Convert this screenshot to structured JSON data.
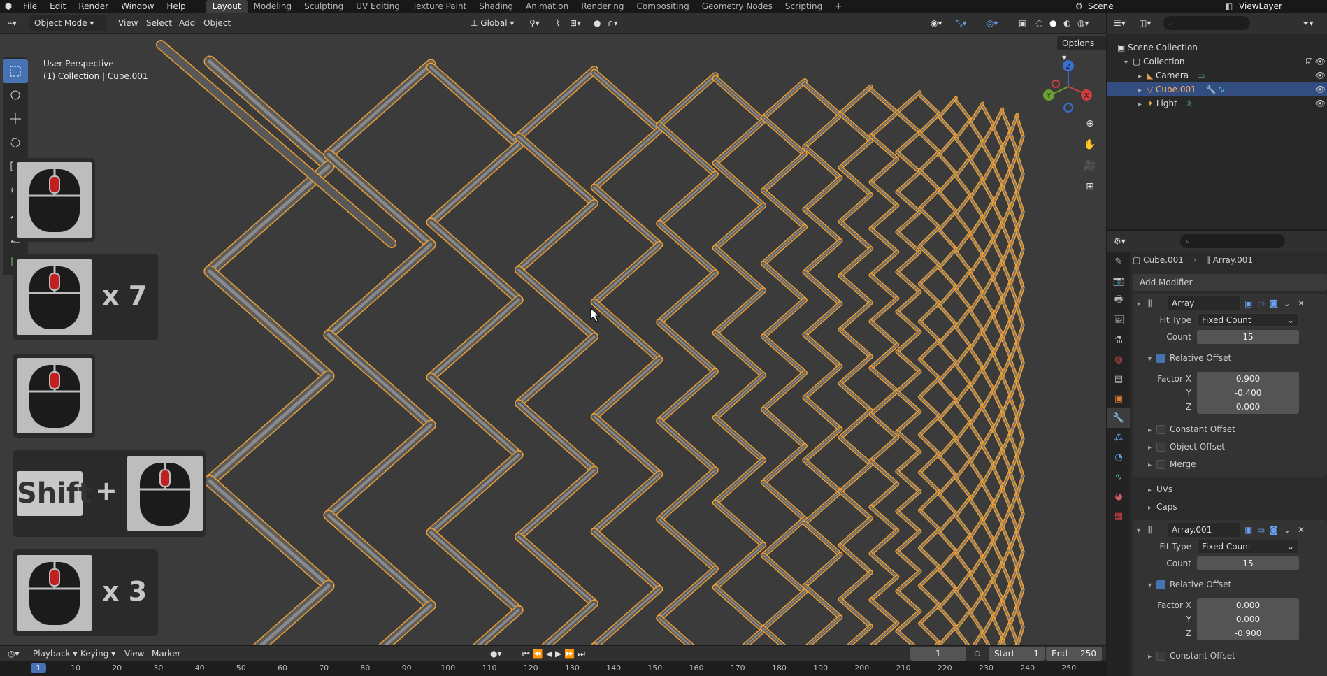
{
  "topbar": {
    "menus": [
      "File",
      "Edit",
      "Render",
      "Window",
      "Help"
    ],
    "workspaces": [
      "Layout",
      "Modeling",
      "Sculpting",
      "UV Editing",
      "Texture Paint",
      "Shading",
      "Animation",
      "Rendering",
      "Compositing",
      "Geometry Nodes",
      "Scripting"
    ],
    "active_workspace": "Layout",
    "scene": "Scene",
    "view_layer": "ViewLayer"
  },
  "viewport_header": {
    "mode": "Object Mode",
    "menus": [
      "View",
      "Select",
      "Add",
      "Object"
    ],
    "orientation": "Global",
    "options": "Options"
  },
  "viewport": {
    "perspective": "User Perspective",
    "collection_info": "(1) Collection | Cube.001",
    "gizmo_axes": [
      "Z",
      "Y",
      "X"
    ]
  },
  "key_overlays": [
    {
      "type": "mouse",
      "button": "middle",
      "repeat": ""
    },
    {
      "type": "mouse",
      "button": "middle",
      "repeat": "x 7"
    },
    {
      "type": "mouse",
      "button": "middle",
      "repeat": ""
    },
    {
      "type": "modifier",
      "key": "Shift",
      "plus": "+",
      "button": "middle"
    },
    {
      "type": "mouse",
      "button": "middle",
      "repeat": "x 3"
    }
  ],
  "timeline": {
    "menus": [
      "Playback",
      "Keying",
      "View",
      "Marker"
    ],
    "current_frame": "1",
    "start_label": "Start",
    "start": "1",
    "end_label": "End",
    "end": "250",
    "ticks": [
      "1",
      "10",
      "20",
      "30",
      "40",
      "50",
      "60",
      "70",
      "80",
      "90",
      "100",
      "110",
      "120",
      "130",
      "140",
      "150",
      "160",
      "170",
      "180",
      "190",
      "200",
      "210",
      "220",
      "230",
      "240",
      "250"
    ]
  },
  "outliner": {
    "root": "Scene Collection",
    "items": [
      {
        "label": "Collection",
        "icon": "collection-icon",
        "selected": false
      },
      {
        "label": "Camera",
        "icon": "camera-icon",
        "selected": false
      },
      {
        "label": "Cube.001",
        "icon": "mesh-icon",
        "selected": true
      },
      {
        "label": "Light",
        "icon": "light-icon",
        "selected": false
      }
    ]
  },
  "properties": {
    "breadcrumb": [
      "Cube.001",
      "Array.001"
    ],
    "add_modifier": "Add Modifier",
    "modifiers": [
      {
        "name": "Array",
        "fit_type_label": "Fit Type",
        "fit_type": "Fixed Count",
        "count_label": "Count",
        "count": "15",
        "relative_offset": "Relative Offset",
        "factor_labels": [
          "Factor X",
          "Y",
          "Z"
        ],
        "factors": [
          "0.900",
          "-0.400",
          "0.000"
        ],
        "subpanels": [
          "Constant Offset",
          "Object Offset",
          "Merge",
          "UVs",
          "Caps"
        ]
      },
      {
        "name": "Array.001",
        "fit_type_label": "Fit Type",
        "fit_type": "Fixed Count",
        "count_label": "Count",
        "count": "15",
        "relative_offset": "Relative Offset",
        "factor_labels": [
          "Factor X",
          "Y",
          "Z"
        ],
        "factors": [
          "0.000",
          "0.000",
          "-0.900"
        ],
        "subpanels": [
          "Constant Offset"
        ]
      }
    ]
  },
  "colors": {
    "accent": "#4772b3",
    "selection_outline": "#f0a030",
    "header": "#303030",
    "viewport_bg": "#3b3b3b"
  }
}
